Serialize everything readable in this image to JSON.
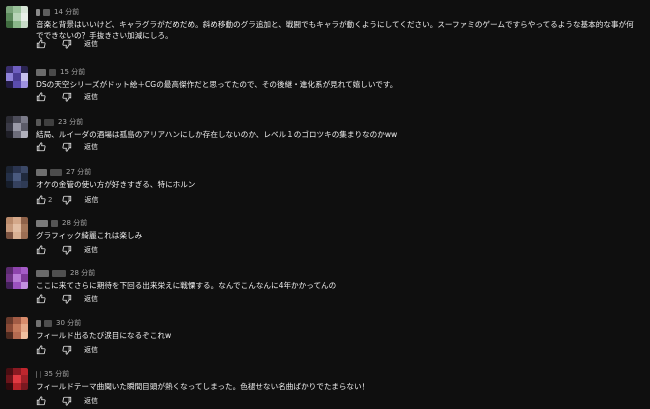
{
  "reply_label": "返信",
  "comments": [
    {
      "time": "14 分前",
      "text": "音楽と背景はいいけど、キャラグラがだめだめ。斜め移動のグラ追加と、戦闘でもキャラが動くようにしてください。スーファミのゲームですらやってるような基本的な事が何でできないの？手抜きさい加減にしろ。",
      "likes": "",
      "avatar": [
        "#7aa37a",
        "#9bc29b",
        "#d8e6d8",
        "#5c8a5c",
        "#b7d4b7",
        "#e8f0e8",
        "#3f6b3f",
        "#8ab88a",
        "#c9dcc9"
      ],
      "name": [
        "#8a8a8a",
        "#5e5e5e"
      ]
    },
    {
      "time": "15 分前",
      "text": "DSの天空シリーズがドット絵＋CGの最高傑作だと思ってたので、その後継・進化系が見れて嬉しいです。",
      "likes": "",
      "avatar": [
        "#3a2f6e",
        "#6f5fc0",
        "#2a2450",
        "#8f82d8",
        "#4b3d94",
        "#c7c0ef",
        "#221b45",
        "#5a4cae",
        "#9e92e0"
      ],
      "name": [
        "#6b6b6b",
        "#4a4a4a"
      ]
    },
    {
      "time": "23 分前",
      "text": "結局、ルイーダの酒場は孤島のアリアハンにしか存在しないのか、レベル１のゴロツキの集まりなのかww",
      "likes": "",
      "avatar": [
        "#2c2c34",
        "#4d4d5a",
        "#7a7a88",
        "#3a3a46",
        "#9a9aa8",
        "#5b5b68",
        "#1e1e26",
        "#6c6c7a",
        "#b0b0bc"
      ],
      "name": [
        "#585858",
        "#3f3f3f"
      ]
    },
    {
      "time": "27 分前",
      "text": "オケの金管の使い方が好きすぎる、特にホルン",
      "likes": "2",
      "avatar": [
        "#1c2433",
        "#2b3550",
        "#3b4866",
        "#243048",
        "#4a5a7e",
        "#202a3d",
        "#161d2a",
        "#35415e",
        "#2f3b55"
      ],
      "name": [
        "#6e6e6e",
        "#4c4c4c"
      ]
    },
    {
      "time": "28 分前",
      "text": "グラフィック綺麗これは楽しみ",
      "likes": "",
      "avatar": [
        "#b98a6b",
        "#d4a88a",
        "#8f6249",
        "#c79a7c",
        "#e2bea4",
        "#a5775a",
        "#7a5240",
        "#d9b093",
        "#9c6e53"
      ],
      "name": [
        "#7a7a7a",
        "#555555"
      ]
    },
    {
      "time": "28 分前",
      "text": "ここに来てさらに期待を下回る出来栄えに戦慄する。なんでこんなんに4年かかってんの",
      "likes": "",
      "avatar": [
        "#5a2a6e",
        "#8e44ad",
        "#a55cc7",
        "#6f3386",
        "#b97dd6",
        "#7e3a99",
        "#43205a",
        "#9b51bf",
        "#c28fe0"
      ],
      "name": [
        "#6a6a6a",
        "#505050"
      ]
    },
    {
      "time": "30 分前",
      "text": "フィールド出るたび涙目になるぞこれw",
      "likes": "",
      "avatar": [
        "#6b3b2c",
        "#a35c45",
        "#d88c6c",
        "#8a4a36",
        "#c47a5c",
        "#e5a888",
        "#4e2a1f",
        "#b46a50",
        "#f0c0a0"
      ],
      "name": [
        "#727272",
        "#4e4e4e"
      ]
    },
    {
      "time": "35 分前",
      "text": "フィールドテーマ曲聞いた瞬間目頭が熱くなってしまった。色褪せない名曲ばかりでたまらない！",
      "likes": "",
      "avatar": [
        "#4a0e12",
        "#8a1a22",
        "#c0262e",
        "#6b141a",
        "#e03a42",
        "#a01f27",
        "#32090c",
        "#b52329",
        "#7a1820"
      ],
      "name": [
        "#5f5f5f",
        "#464646"
      ]
    }
  ]
}
